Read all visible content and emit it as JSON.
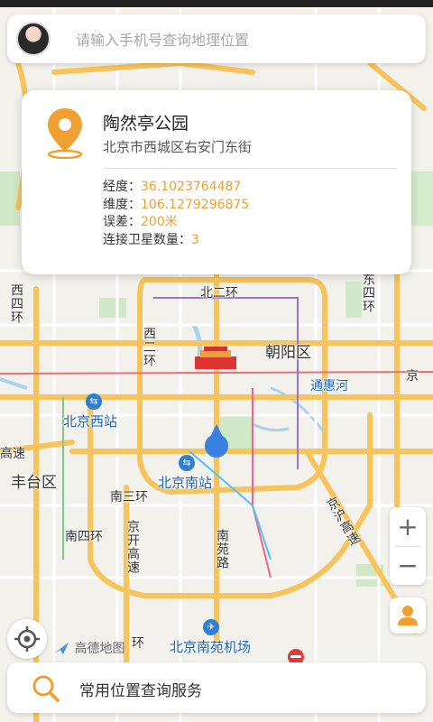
{
  "search": {
    "placeholder": "请输入手机号查询地理位置"
  },
  "info_card": {
    "place_name": "陶然亭公园",
    "address": "北京市西城区右安门东街",
    "longitude_label": "经度：",
    "longitude_value": "36.1023764487",
    "latitude_label": "维度：",
    "latitude_value": "106.1279296875",
    "error_label": "误差：",
    "error_value": "200米",
    "satellites_label": "连接卫星数量：",
    "satellites_value": "3"
  },
  "map_labels": {
    "north_second_ring": "北二环",
    "west_second_ring": "西二环",
    "west_fourth_ring": "西四环",
    "east_fourth_ring": "东四环",
    "chaoyang": "朝阳区",
    "tonghui_river": "通惠河",
    "beijing_west_station": "北京西站",
    "beijing_south_station": "北京南站",
    "fengtai": "丰台区",
    "south_third_ring": "南三环",
    "south_fourth_ring": "南四环",
    "jingkai_expressway": "京开高速",
    "nanyuan_road": "南苑路",
    "jinghu_expressway": "京沪高速",
    "nanyuan_airport": "北京南苑机场",
    "gaosu": "高速",
    "jing_partial": "京",
    "huan": "环",
    "amap": "高德地图"
  },
  "controls": {
    "zoom_in": "+",
    "zoom_out": "−"
  },
  "bottom_bar": {
    "label": "常用位置查询服务"
  },
  "colors": {
    "accent": "#f0a030",
    "road_major": "#f7c35a",
    "location_dot": "#3a80e0"
  }
}
